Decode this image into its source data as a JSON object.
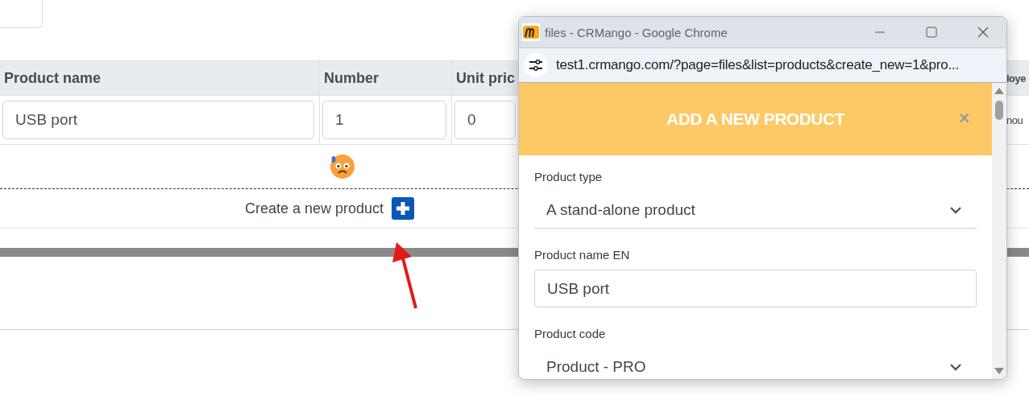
{
  "background_page": {
    "table": {
      "columns": [
        "Product name",
        "Number",
        "Unit pric",
        "loye"
      ],
      "rows": [
        {
          "product_name": "USB port",
          "number": "1",
          "unit_price": "0",
          "column_4": "nou"
        }
      ]
    },
    "create_link": "Create a new product"
  },
  "popup_window": {
    "title": "files - CRMango - Google Chrome",
    "url": "test1.crmango.com/?page=files&list=products&create_new=1&pro...",
    "dialog": {
      "title": "ADD A NEW PRODUCT",
      "close": "×",
      "fields": [
        {
          "kind": "select",
          "label": "Product type",
          "value": "A stand-alone product"
        },
        {
          "kind": "input",
          "label": "Product name EN",
          "value": "USB port"
        },
        {
          "kind": "select",
          "label": "Product code",
          "value": "Product - PRO"
        }
      ]
    }
  }
}
